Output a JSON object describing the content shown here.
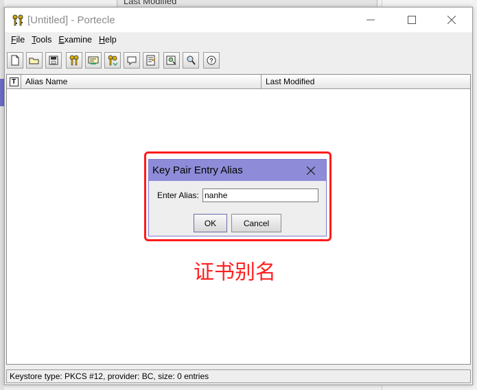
{
  "background": {
    "behind_header_text": "Last Modified"
  },
  "window": {
    "title": "[Untitled] - Portecle",
    "icons": {
      "app": "keys-icon",
      "minimize": "minimize-icon",
      "maximize": "maximize-icon",
      "close": "close-icon"
    }
  },
  "menu": {
    "items": [
      {
        "mnemonic": "F",
        "rest": "ile"
      },
      {
        "mnemonic": "T",
        "rest": "ools"
      },
      {
        "mnemonic": "E",
        "rest": "xamine"
      },
      {
        "mnemonic": "H",
        "rest": "elp"
      }
    ]
  },
  "toolbar": {
    "buttons": [
      "new-keystore-icon",
      "open-keystore-icon",
      "save-keystore-icon",
      "generate-keypair-icon",
      "import-trusted-cert-icon",
      "import-keypair-icon",
      "keystore-report-icon",
      "examine-certificate-icon",
      "examine-crl-icon",
      "examine-ssl-icon",
      "help-icon"
    ]
  },
  "table": {
    "type_header_glyph": "T",
    "columns": [
      "Alias Name",
      "Last Modified"
    ]
  },
  "status": {
    "text": "Keystore type: PKCS #12, provider: BC, size: 0 entries"
  },
  "dialog": {
    "title": "Key Pair Entry Alias",
    "alias_label": "Enter Alias:",
    "alias_value": "nanhe",
    "ok_label": "OK",
    "cancel_label": "Cancel"
  },
  "annotation": {
    "text": "证书别名",
    "color": "#ff2020"
  }
}
